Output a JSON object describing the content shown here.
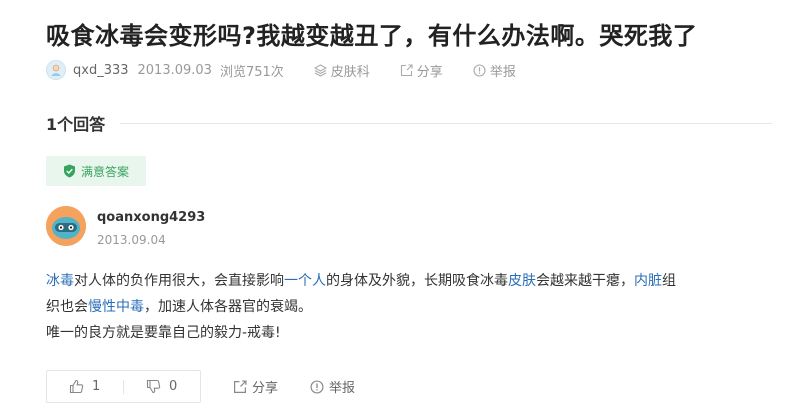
{
  "question": {
    "title": "吸食冰毒会变形吗?我越变越丑了，有什么办法啊。哭死我了",
    "author": "qxd_333",
    "date": "2013.09.03",
    "views": "浏览751次",
    "category": "皮肤科",
    "share_label": "分享",
    "report_label": "举报"
  },
  "answers": {
    "count_label": "1个回答",
    "badge_label": "满意答案",
    "answerer": "qoanxong4293",
    "date": "2013.09.04",
    "content": {
      "l1_link1": "冰毒",
      "l1_t1": "对人体的负作用很大，会直接影响",
      "l1_link2": "一个人",
      "l1_t2": "的身体及外貌，长期吸食冰毒",
      "l1_link3": "皮肤",
      "l1_t3": "会越来越干瘪，",
      "l1_link4": "内脏",
      "l1_t4": "组",
      "l2_t1": "织也会",
      "l2_link1": "慢性中毒",
      "l2_t2": "，加速人体各器官的衰竭。",
      "l3_t1": "唯一的良方就是要靠自己的毅力-戒毒!"
    },
    "upvotes": "1",
    "downvotes": "0",
    "share_label": "分享",
    "report_label": "举报"
  },
  "colors": {
    "link": "#2b6fb8",
    "badge_text": "#38a35f",
    "badge_bg": "#e9f6ee",
    "avatar_bg": "#f4a25d"
  },
  "icons": [
    "user-avatar-icon",
    "layers-icon",
    "share-icon",
    "report-icon",
    "shield-check-icon",
    "thumb-up-icon",
    "thumb-down-icon"
  ]
}
